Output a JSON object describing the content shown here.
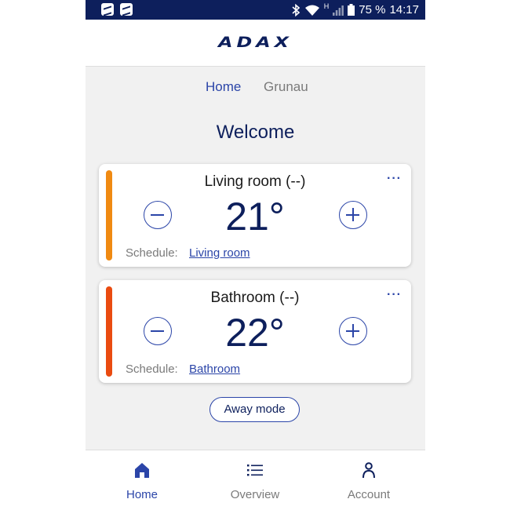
{
  "status_bar": {
    "battery": "75 %",
    "time": "14:17",
    "network_indicator": "H",
    "icons": [
      "app-notification-icon",
      "app-notification-icon",
      "bluetooth-icon",
      "wifi-icon",
      "signal-icon",
      "battery-icon"
    ]
  },
  "header": {
    "logo_text": "ADAX"
  },
  "top_tabs": [
    {
      "label": "Home",
      "active": true
    },
    {
      "label": "Grunau",
      "active": false
    }
  ],
  "welcome": "Welcome",
  "rooms": [
    {
      "name": "Living room (--)",
      "temperature": "21°",
      "schedule_label": "Schedule:",
      "schedule_value": "Living room",
      "accent_color": "#f08a12"
    },
    {
      "name": "Bathroom (--)",
      "temperature": "22°",
      "schedule_label": "Schedule:",
      "schedule_value": "Bathroom",
      "accent_color": "#ea4b10"
    }
  ],
  "away_mode_label": "Away mode",
  "bottom_nav": [
    {
      "label": "Home",
      "icon": "home-icon",
      "active": true
    },
    {
      "label": "Overview",
      "icon": "list-icon",
      "active": false
    },
    {
      "label": "Account",
      "icon": "person-icon",
      "active": false
    }
  ],
  "colors": {
    "primary": "#2b45a8",
    "dark_navy": "#0d1f5c",
    "background": "#f1f1f1",
    "inactive": "#7a7a7a"
  }
}
